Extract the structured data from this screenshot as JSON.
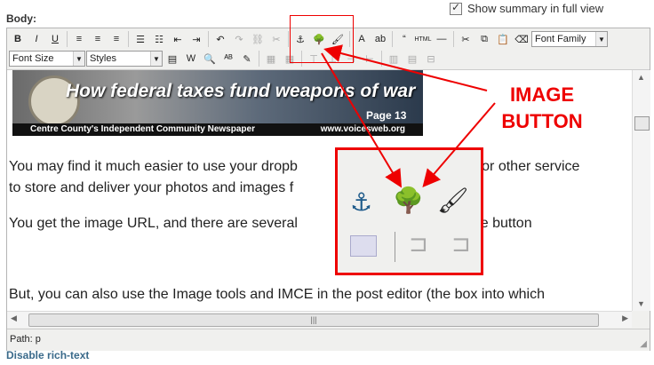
{
  "header": {
    "body_label": "Body:",
    "show_summary_label": "Show summary in full view",
    "show_summary_checked": true
  },
  "toolbar": {
    "row1": [
      {
        "name": "bold-button",
        "glyph": "B",
        "dim": false
      },
      {
        "name": "italic-button",
        "glyph": "I",
        "dim": false
      },
      {
        "name": "underline-button",
        "glyph": "U",
        "dim": false
      },
      {
        "name": "align-left-button",
        "glyph": "≡",
        "dim": false
      },
      {
        "name": "align-center-button",
        "glyph": "≡",
        "dim": false
      },
      {
        "name": "align-right-button",
        "glyph": "≡",
        "dim": false
      },
      {
        "name": "bullet-list-button",
        "glyph": "☰",
        "dim": false
      },
      {
        "name": "numbered-list-button",
        "glyph": "☷",
        "dim": false
      },
      {
        "name": "outdent-button",
        "glyph": "⇤",
        "dim": false
      },
      {
        "name": "indent-button",
        "glyph": "⇥",
        "dim": false
      },
      {
        "name": "undo-button",
        "glyph": "↶",
        "dim": false
      },
      {
        "name": "redo-button",
        "glyph": "↷",
        "dim": true
      },
      {
        "name": "link-button",
        "glyph": "⛓",
        "dim": true
      },
      {
        "name": "unlink-button",
        "glyph": "✂",
        "dim": true
      },
      {
        "name": "anchor-button",
        "glyph": "⚓",
        "dim": false
      },
      {
        "name": "image-button",
        "glyph": "🌳",
        "dim": false
      },
      {
        "name": "cleanup-button",
        "glyph": "🖌",
        "dim": false
      },
      {
        "name": "font-color-button",
        "glyph": "A",
        "dim": false
      },
      {
        "name": "highlight-color-button",
        "glyph": "ab",
        "dim": false
      },
      {
        "name": "blockquote-button",
        "glyph": "“",
        "dim": false
      },
      {
        "name": "html-button",
        "glyph": "HTML",
        "dim": false
      },
      {
        "name": "horizontal-rule-button",
        "glyph": "—",
        "dim": false
      },
      {
        "name": "cut-button",
        "glyph": "✂",
        "dim": false
      },
      {
        "name": "copy-button",
        "glyph": "⧉",
        "dim": false
      },
      {
        "name": "paste-button",
        "glyph": "📋",
        "dim": false
      },
      {
        "name": "eraser-button",
        "glyph": "⌫",
        "dim": false
      }
    ],
    "font_family": "Font Family",
    "font_size": "Font Size",
    "styles": "Styles",
    "row2": [
      {
        "name": "paste-text-button",
        "glyph": "▤",
        "dim": false
      },
      {
        "name": "paste-word-button",
        "glyph": "W",
        "dim": false
      },
      {
        "name": "find-button",
        "glyph": "🔍",
        "dim": false
      },
      {
        "name": "spellcheck-button",
        "glyph": "ᴬᴮ",
        "dim": false
      },
      {
        "name": "edit-button",
        "glyph": "✎",
        "dim": false
      },
      {
        "name": "table-button",
        "glyph": "▦",
        "dim": true
      },
      {
        "name": "table-props-button",
        "glyph": "▦",
        "dim": true
      },
      {
        "name": "row-before-button",
        "glyph": "⊤",
        "dim": true
      },
      {
        "name": "row-after-button",
        "glyph": "⊥",
        "dim": true
      },
      {
        "name": "col-before-button",
        "glyph": "⊣",
        "dim": true
      },
      {
        "name": "col-after-button",
        "glyph": "⊢",
        "dim": true
      },
      {
        "name": "merge-cells-button",
        "glyph": "▥",
        "dim": true
      },
      {
        "name": "split-cells-button",
        "glyph": "▤",
        "dim": true
      },
      {
        "name": "delete-table-button",
        "glyph": "⊟",
        "dim": true
      }
    ]
  },
  "content": {
    "banner_headline": "How federal taxes fund weapons of war",
    "banner_page": "Page 13",
    "banner_footer_left": "Centre County's Independent Community Newspaper",
    "banner_footer_right": "www.voicesweb.org",
    "para1_line1": "You may find it much easier to use your dropb",
    "para1_line1_tail": "nt, or other service",
    "para1_line2": "to store and deliver your photos and images f",
    "para2_line1": "You get the image URL, and there are several",
    "para2_line1_tail": "k the image button",
    "para3_line1": "But, you can also use the Image tools and IMCE in the post editor (the box into which"
  },
  "status": {
    "path_label": "Path: p"
  },
  "footer": {
    "disable_rich_text": "Disable rich-text"
  },
  "annotation": {
    "label_line1": "IMAGE",
    "label_line2": "BUTTON",
    "color": "#e00000"
  }
}
